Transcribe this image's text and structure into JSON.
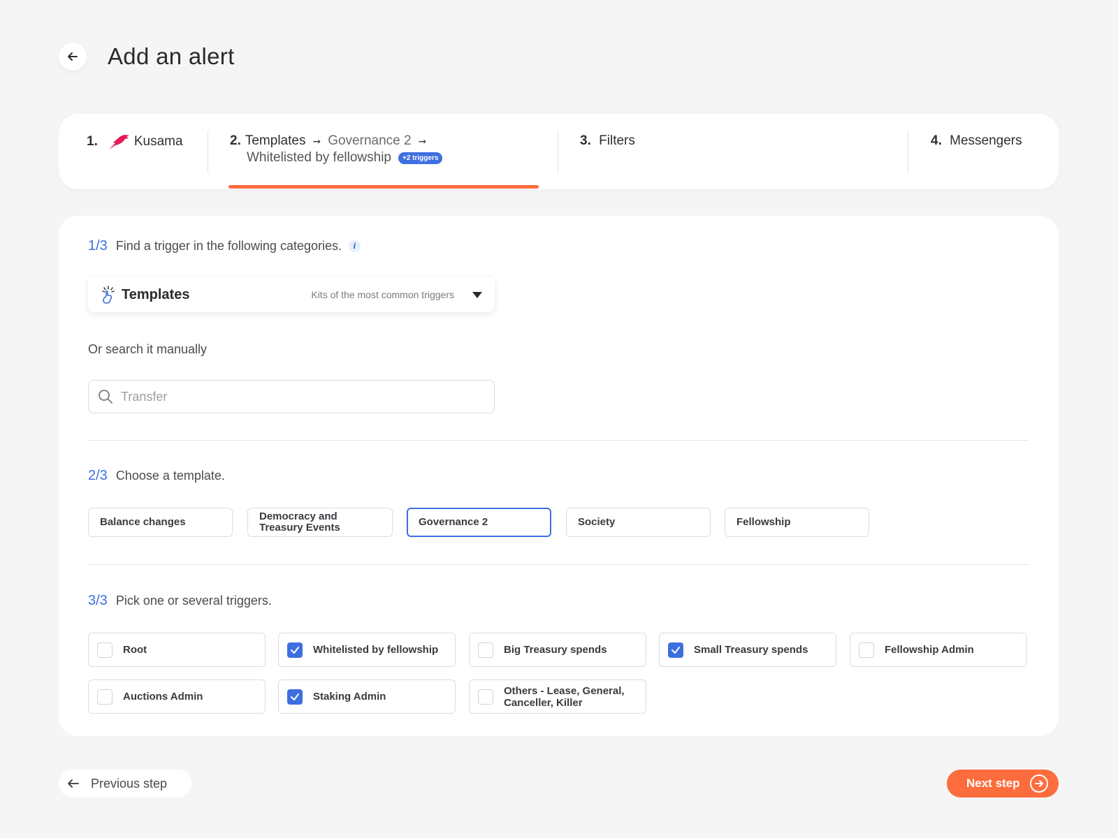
{
  "page": {
    "title": "Add an alert"
  },
  "stepper": {
    "step1": {
      "num": "1.",
      "label": "Kusama"
    },
    "step2": {
      "num": "2.",
      "label": "Templates",
      "crumb": "Governance 2",
      "sub": "Whitelisted by fellowship",
      "badge": "+2 triggers"
    },
    "step3": {
      "num": "3.",
      "label": "Filters"
    },
    "step4": {
      "num": "4.",
      "label": "Messengers"
    }
  },
  "section1": {
    "index": "1/3",
    "text": "Find a trigger in the following categories.",
    "dropdown": {
      "title": "Templates",
      "subtitle": "Kits of the most common triggers"
    },
    "or_text": "Or search it manually",
    "search_placeholder": "Transfer",
    "search_value": ""
  },
  "section2": {
    "index": "2/3",
    "text": "Choose a template.",
    "templates": [
      {
        "label": "Balance changes",
        "selected": false
      },
      {
        "label": "Democracy and Treasury Events",
        "selected": false
      },
      {
        "label": "Governance 2",
        "selected": true
      },
      {
        "label": "Society",
        "selected": false
      },
      {
        "label": "Fellowship",
        "selected": false
      }
    ]
  },
  "section3": {
    "index": "3/3",
    "text": "Pick one or several triggers.",
    "triggers": [
      {
        "label": "Root",
        "checked": false
      },
      {
        "label": "Whitelisted by fellowship",
        "checked": true
      },
      {
        "label": "Big Treasury spends",
        "checked": false
      },
      {
        "label": "Small Treasury spends",
        "checked": true
      },
      {
        "label": "Fellowship Admin",
        "checked": false
      },
      {
        "label": "Auctions Admin",
        "checked": false
      },
      {
        "label": "Staking Admin",
        "checked": true
      },
      {
        "label": "Others - Lease, General, Canceller, Killer",
        "checked": false
      }
    ]
  },
  "footer": {
    "prev_label": "Previous step",
    "next_label": "Next step"
  },
  "colors": {
    "accent": "#3d6fe0",
    "brand": "#fd6c3c",
    "kusama": "#e6195a"
  },
  "icons": [
    "arrow-left-icon",
    "kusama-bird-icon",
    "arrow-right-icon",
    "info-icon",
    "hand-sparkle-icon",
    "chevron-down-icon",
    "search-icon",
    "check-icon",
    "arrow-right-circle-icon"
  ]
}
